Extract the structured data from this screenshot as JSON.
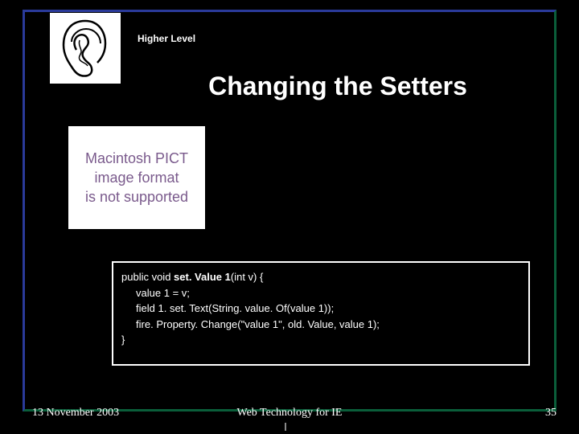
{
  "header": {
    "higher_level": "Higher Level",
    "title": "Changing the Setters"
  },
  "pict": {
    "line1": "Macintosh PICT",
    "line2": "image format",
    "line3": "is not supported"
  },
  "code": {
    "line1_prefix": "public void ",
    "line1_bold": "set. Value 1",
    "line1_suffix": "(int v) {",
    "line2": "     value 1 = v;",
    "line3": "     field 1. set. Text(String. value. Of(value 1));",
    "line4": "     fire. Property. Change(\"value 1\", old. Value, value 1);",
    "line5": "}"
  },
  "footer": {
    "date": "13 November 2003",
    "center": "Web Technology for IE",
    "page": "35"
  }
}
